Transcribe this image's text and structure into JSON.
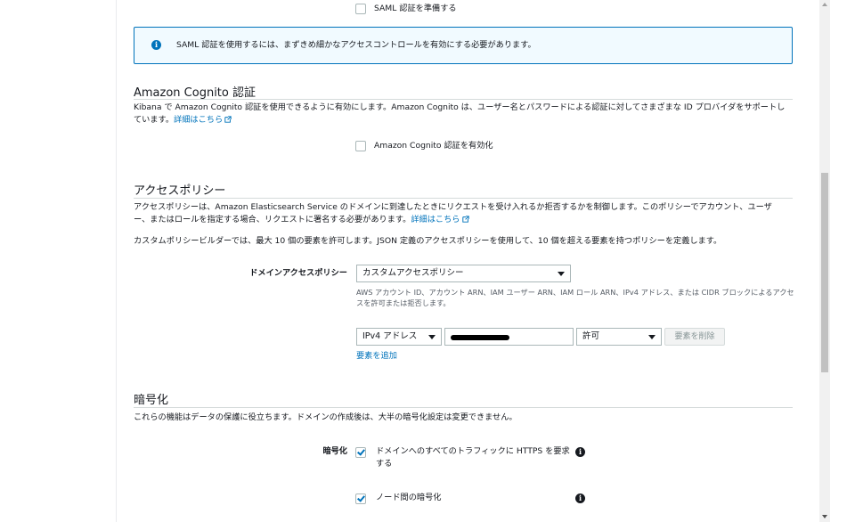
{
  "saml": {
    "prepare_label": "SAML 認証を準備する",
    "info_text": "SAML 認証を使用するには、まずきめ細かなアクセスコントロールを有効にする必要があります。"
  },
  "cognito": {
    "title": "Amazon Cognito 認証",
    "description": "Kibana で Amazon Cognito 認証を使用できるように有効にします。Amazon Cognito は、ユーザー名とパスワードによる認証に対してさまざまな ID プロバイダをサポートし",
    "description_cont": "ています。",
    "learn_more": "詳細はこちら",
    "enable_label": "Amazon Cognito 認証を有効化"
  },
  "access_policy": {
    "title": "アクセスポリシー",
    "description": "アクセスポリシーは、Amazon Elasticsearch Service のドメインに到達したときにリクエストを受け入れるか拒否するかを制御します。このポリシーでアカウント、ユーザ",
    "description_cont": "ー、またはロールを指定する場合、リクエストに署名する必要があります。",
    "learn_more": "詳細はこちら",
    "builder_note": "カスタムポリシービルダーでは、最大 10 個の要素を許可します。JSON 定義のアクセスポリシーを使用して、10 個を超える要素を持つポリシーを定義します。",
    "domain_policy_label": "ドメインアクセスポリシー",
    "domain_policy_value": "カスタムアクセスポリシー",
    "help_text_1": "AWS アカウント ID、アカウント ARN、IAM ユーザー ARN、IAM ロール ARN、IPv4 アドレス、または CIDR ブロックによるアクセ",
    "help_text_2": "スを許可または拒否します。",
    "element_type": "IPv4 アドレス",
    "element_effect": "許可",
    "remove_button": "要素を削除",
    "add_element": "要素を追加"
  },
  "encryption": {
    "title": "暗号化",
    "description": "これらの機能はデータの保護に役立ちます。ドメインの作成後は、大半の暗号化設定は変更できません。",
    "label": "暗号化",
    "https_label_1": "ドメインへのすべてのトラフィックに HTTPS を要求",
    "https_label_2": "する",
    "node_to_node": "ノード間の暗号化"
  },
  "colors": {
    "link": "#0073bb",
    "info_border": "#0073bb",
    "info_bg": "#f1faff"
  }
}
